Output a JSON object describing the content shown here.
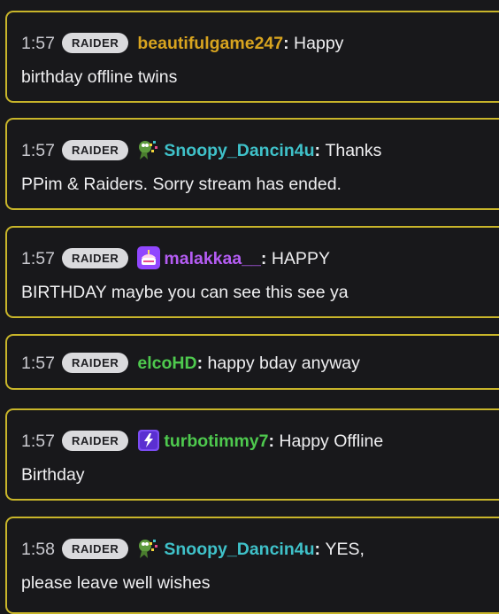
{
  "messages": [
    {
      "time": "1:57",
      "badge": "RAIDER",
      "user": "beautifulgame247",
      "user_color": "#d8a41f",
      "icon": "",
      "line1": "Happy",
      "line2": "birthday offline twins"
    },
    {
      "time": "1:57",
      "badge": "RAIDER",
      "user": "Snoopy_Dancin4u",
      "user_color": "#3fc1c9",
      "icon": "dancing-frog-emote-icon",
      "line1": "Thanks",
      "line2": "PPim & Raiders. Sorry stream has ended."
    },
    {
      "time": "1:57",
      "badge": "RAIDER",
      "user": "malakkaa__",
      "user_color": "#b45cf3",
      "icon": "birthday-cake-badge-icon",
      "line1": "HAPPY",
      "line2": "BIRTHDAY maybe you can see this see ya"
    },
    {
      "time": "1:57",
      "badge": "RAIDER",
      "user": "elcoHD",
      "user_color": "#4ec94e",
      "icon": "",
      "line1": "happy bday anyway",
      "line2": ""
    },
    {
      "time": "1:57",
      "badge": "RAIDER",
      "user": "turbotimmy7",
      "user_color": "#4ec94e",
      "icon": "turbo-bolt-badge-icon",
      "line1": "Happy Offline",
      "line2": "Birthday"
    },
    {
      "time": "1:58",
      "badge": "RAIDER",
      "user": "Snoopy_Dancin4u",
      "user_color": "#3fc1c9",
      "icon": "dancing-frog-emote-icon",
      "line1": "YES,",
      "line2": "please leave well wishes"
    }
  ]
}
